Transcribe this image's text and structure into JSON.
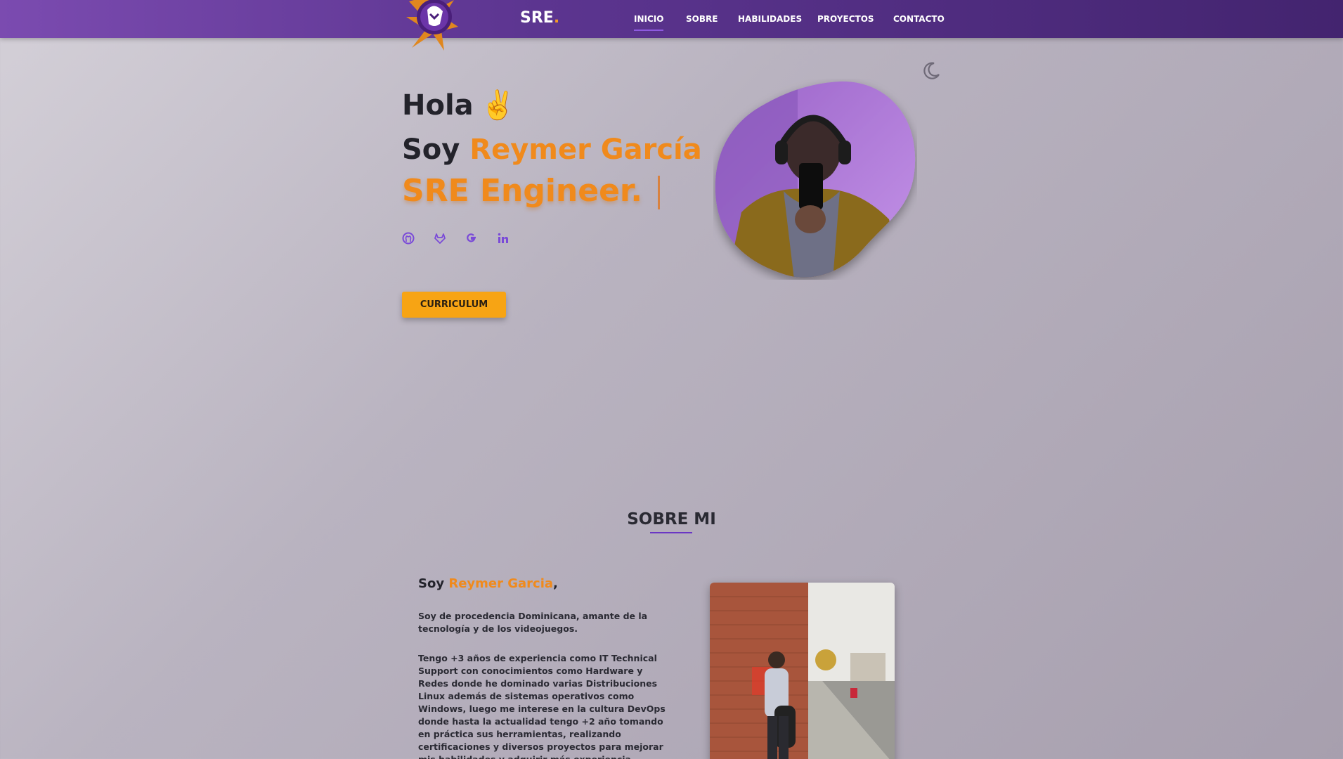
{
  "header": {
    "brand": "SRE",
    "brand_dot": ".",
    "nav": [
      {
        "label": "INICIO",
        "active": true
      },
      {
        "label": "SOBRE"
      },
      {
        "label": "HABILIDADES"
      },
      {
        "label": "PROYECTOS"
      },
      {
        "label": "CONTACTO"
      }
    ]
  },
  "hero": {
    "greeting": "Hola",
    "greeting_emoji": "✌️",
    "soy": "Soy ",
    "name": "Reymer García",
    "role": "SRE Engineer.",
    "socials": [
      "github-icon",
      "gitlab-icon",
      "google-icon",
      "linkedin-icon"
    ],
    "cv_button": "CURRICULUM"
  },
  "about": {
    "title": "SOBRE MI",
    "heading_prefix": "Soy ",
    "heading_name": "Reymer Garcia",
    "heading_suffix": ",",
    "p1": "Soy de procedencia Dominicana, amante de la tecnología y de los videojuegos.",
    "p2": "Tengo +3 años de experiencia como IT Technical Support con conocimientos como Hardware y Redes donde he dominado varias Distribuciones Linux además de sistemas operativos como Windows, luego me interese en la cultura DevOps donde hasta la actualidad tengo +2 año tomando en práctica sus herramientas, realizando certificaciones y diversos proyectos para mejorar mis habilidades y adquirir más experiencia."
  },
  "colors": {
    "accent": "#f08a1c",
    "header": "#5c3590",
    "button": "#f7a414",
    "icon": "#7a4ad8"
  }
}
